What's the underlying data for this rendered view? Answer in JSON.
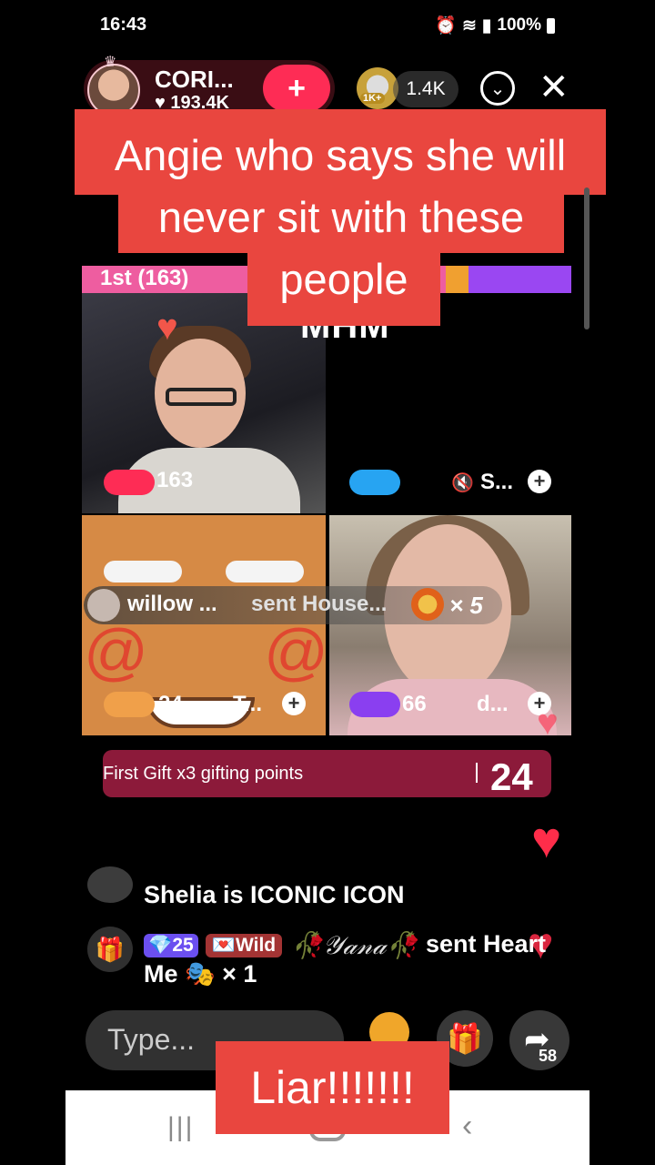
{
  "status_bar": {
    "time": "16:43",
    "battery": "100%"
  },
  "host": {
    "name": "CORI...",
    "likes": "♥ 193.4K",
    "follow_label": "+"
  },
  "viewers": {
    "badge": "1K+",
    "count": "1.4K"
  },
  "captions": {
    "line1": "Angie who says she will",
    "line2": "never sit with these",
    "line3": "people",
    "bottom": "Liar!!!!!!!"
  },
  "battle": {
    "rank": "1st (163)",
    "overlay_text": "MHM"
  },
  "tiles": [
    {
      "score": "163",
      "pill_color": "#fe2c55"
    },
    {
      "score": "",
      "pill_color": "#27a4f2",
      "name": "S..."
    },
    {
      "score": "24",
      "pill_color": "#f0a04a",
      "name": "T..."
    },
    {
      "score": "66",
      "pill_color": "#8a3ff0",
      "name": "d..."
    }
  ],
  "gift_banner": {
    "user": "willow ...",
    "message": "sent House...",
    "count": "× 5"
  },
  "points": {
    "label": "First Gift x3 gifting points",
    "value": "24"
  },
  "chat": {
    "line1": "Shelia is ICONIC ICON",
    "badge_level": "💎25",
    "badge_tag": "💌Wild",
    "user2": "🥀𝒴𝒶𝓃𝒶🥀",
    "sent2": "sent Heart",
    "line3": "Me 🎭 × 1"
  },
  "input": {
    "placeholder": "Type..."
  },
  "share": {
    "count": "58"
  },
  "colors": {
    "caption_red": "#e9463f",
    "accent_pink": "#fe2c55",
    "points_bar": "#8c1a3a"
  }
}
